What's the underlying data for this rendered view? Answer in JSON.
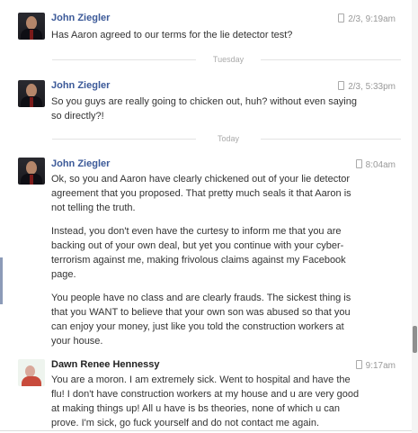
{
  "messages": [
    {
      "sender": "John Ziegler",
      "time": "2/3, 9:19am",
      "paragraphs": [
        "Has Aaron agreed to our terms for the lie detector test?"
      ]
    },
    {
      "sender": "John Ziegler",
      "time": "2/3, 5:33pm",
      "paragraphs": [
        "So you guys are really going to chicken out, huh? without even saying so directly?!"
      ]
    },
    {
      "sender": "John Ziegler",
      "time": "8:04am",
      "paragraphs": [
        "Ok, so you and Aaron have clearly chickened out of your lie detector agreement that you proposed. That pretty much seals it that Aaron is not telling the truth.",
        "Instead, you don't even have the curtesy to inform me that you are backing out of your own deal, but yet you continue with your cyber-terrorism against me, making frivolous claims against my Facebook page.",
        "You people have no class and are clearly frauds. The sickest thing is that you WANT to believe that your own son was abused so that you can enjoy your money, just like you told the construction workers at your house."
      ]
    },
    {
      "sender": "Dawn Renee Hennessy",
      "time": "9:17am",
      "paragraphs": [
        "You are a moron. I am extremely sick. Went to hospital and have the flu! I don't have construction workers at my house and u are very good at making things up! All u have is bs theories, none of which u can prove. I'm sick, go fuck yourself and do not contact me again."
      ]
    }
  ],
  "dividers": [
    "Tuesday",
    "Today"
  ],
  "icons": {
    "sent_via": "mobile-phone-icon"
  },
  "colors": {
    "sender_link": "#3b5998",
    "timestamp": "#999999",
    "divider": "#e3e3e3"
  }
}
